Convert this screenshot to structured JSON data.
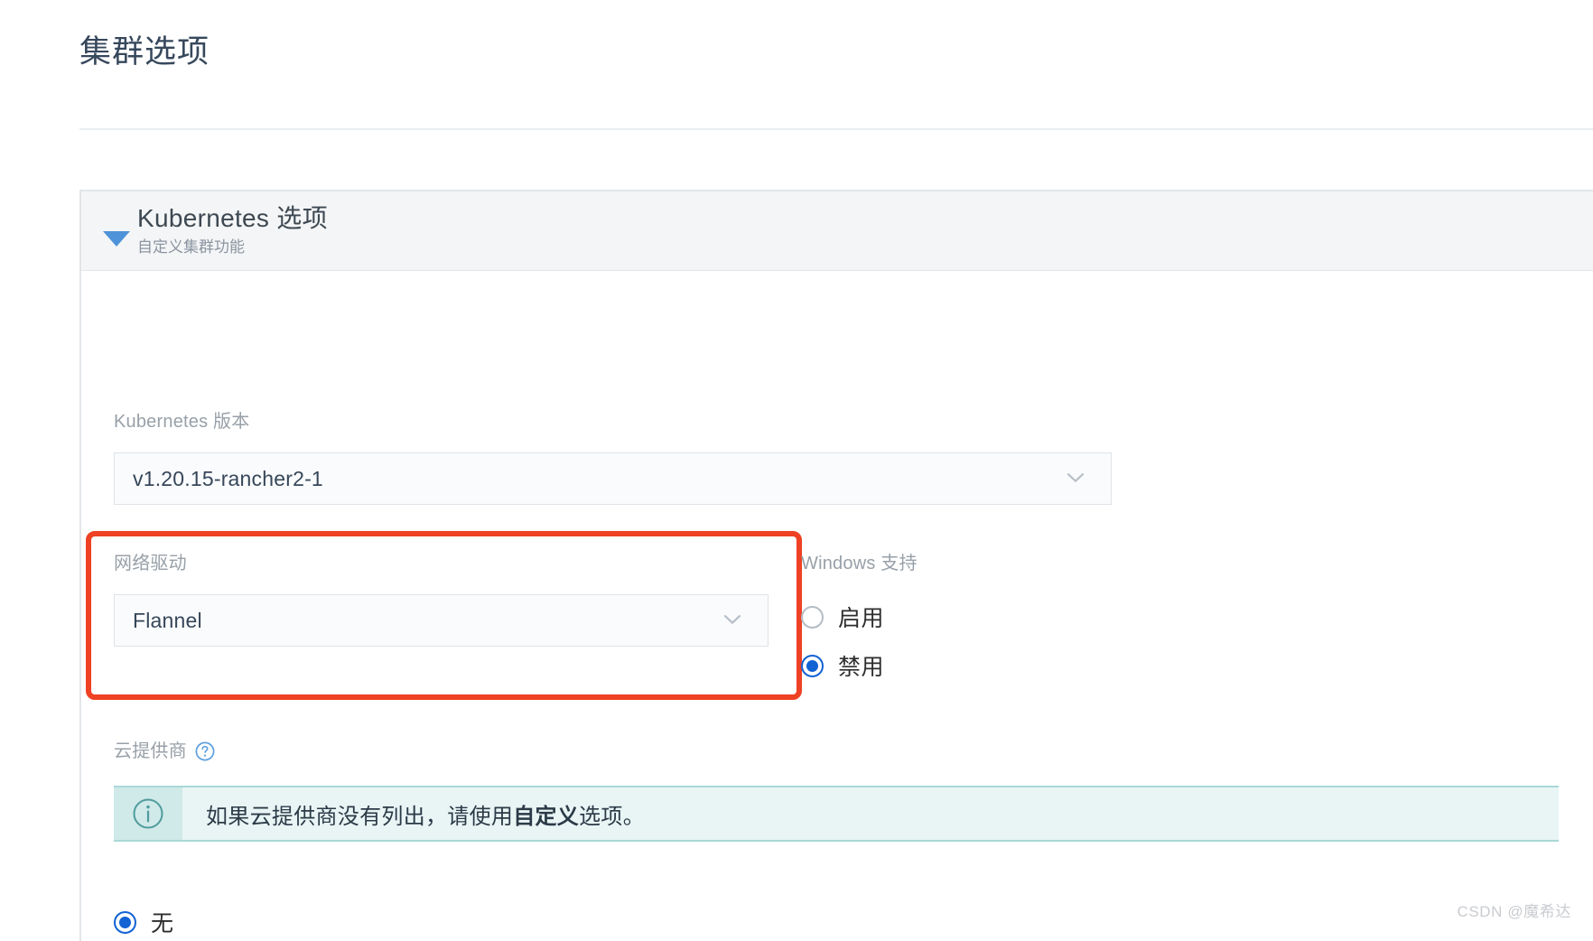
{
  "page": {
    "title": "集群选项"
  },
  "panel": {
    "title": "Kubernetes 选项",
    "subtitle": "自定义集群功能",
    "disclosure_icon": "triangle-down-icon",
    "expanded": true
  },
  "fields": {
    "k8s_version": {
      "label": "Kubernetes 版本",
      "value": "v1.20.15-rancher2-1",
      "chevron_icon": "chevron-down-icon"
    },
    "network_driver": {
      "label": "网络驱动",
      "value": "Flannel",
      "chevron_icon": "chevron-down-icon",
      "highlighted": true,
      "highlight_color": "#ef4123"
    },
    "windows_support": {
      "label": "Windows 支持",
      "options": [
        {
          "label": "启用",
          "checked": false
        },
        {
          "label": "禁用",
          "checked": true
        }
      ],
      "selected": "禁用"
    },
    "cloud_provider": {
      "label": "云提供商",
      "help_icon": "question-circle-icon",
      "info": {
        "icon": "info-circle-icon",
        "text_before": "如果云提供商没有列出，请使用",
        "text_bold": "自定义",
        "text_after": "选项。"
      },
      "first_option": {
        "label": "无",
        "checked": true
      }
    }
  },
  "colors": {
    "accent_blue": "#4e93d9",
    "radio_blue": "#1262d4",
    "highlight_red": "#ef4123",
    "info_bg": "#e9f5f5",
    "info_border": "#a9d8d8",
    "header_bg": "#f4f5f6",
    "title_text": "#37485c",
    "label_text": "#98a0a8"
  },
  "watermark": {
    "text": "CSDN @魔希达"
  }
}
